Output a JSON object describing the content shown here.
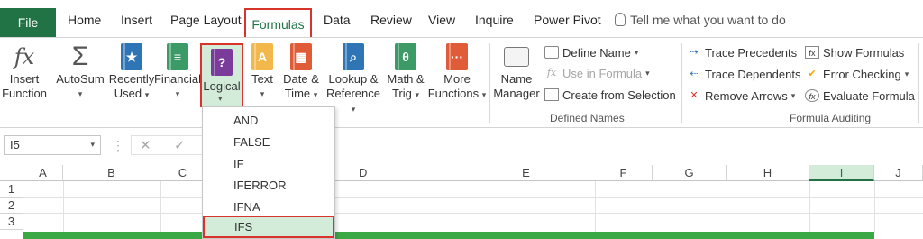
{
  "tabs": {
    "file": "File",
    "home": "Home",
    "insert": "Insert",
    "page_layout": "Page Layout",
    "formulas": "Formulas",
    "data": "Data",
    "review": "Review",
    "view": "View",
    "inquire": "Inquire",
    "power_pivot": "Power Pivot",
    "tell_me": "Tell me what you want to do"
  },
  "ribbon": {
    "insert_function": [
      "Insert",
      "Function"
    ],
    "autosum": "AutoSum",
    "recently_used": [
      "Recently",
      "Used"
    ],
    "financial": "Financial",
    "logical": "Logical",
    "text": "Text",
    "date_time": [
      "Date &",
      "Time"
    ],
    "lookup": [
      "Lookup &",
      "Reference"
    ],
    "math": [
      "Math &",
      "Trig"
    ],
    "more": [
      "More",
      "Functions"
    ],
    "name_manager": [
      "Name",
      "Manager"
    ],
    "define_name": "Define Name",
    "use_in_formula": "Use in Formula",
    "create_from_selection": "Create from Selection",
    "defined_names_label": "Defined Names",
    "trace_precedents": "Trace Precedents",
    "trace_dependents": "Trace Dependents",
    "remove_arrows": "Remove Arrows",
    "show_formulas": "Show Formulas",
    "error_checking": "Error Checking",
    "evaluate_formula": "Evaluate Formula",
    "formula_auditing_label": "Formula Auditing"
  },
  "formula_bar": {
    "name_box": "I5",
    "cancel": "✕",
    "enter": "✓"
  },
  "grid": {
    "columns": [
      "A",
      "B",
      "C",
      "D",
      "E",
      "F",
      "G",
      "H",
      "I",
      "J"
    ],
    "rows": [
      "1",
      "2",
      "3"
    ]
  },
  "logical_menu": [
    "AND",
    "FALSE",
    "IF",
    "IFERROR",
    "IFNA",
    "IFS"
  ],
  "colors": {
    "accent": "#217346",
    "highlight": "#d9342b",
    "selected": "#d3ecd9"
  }
}
